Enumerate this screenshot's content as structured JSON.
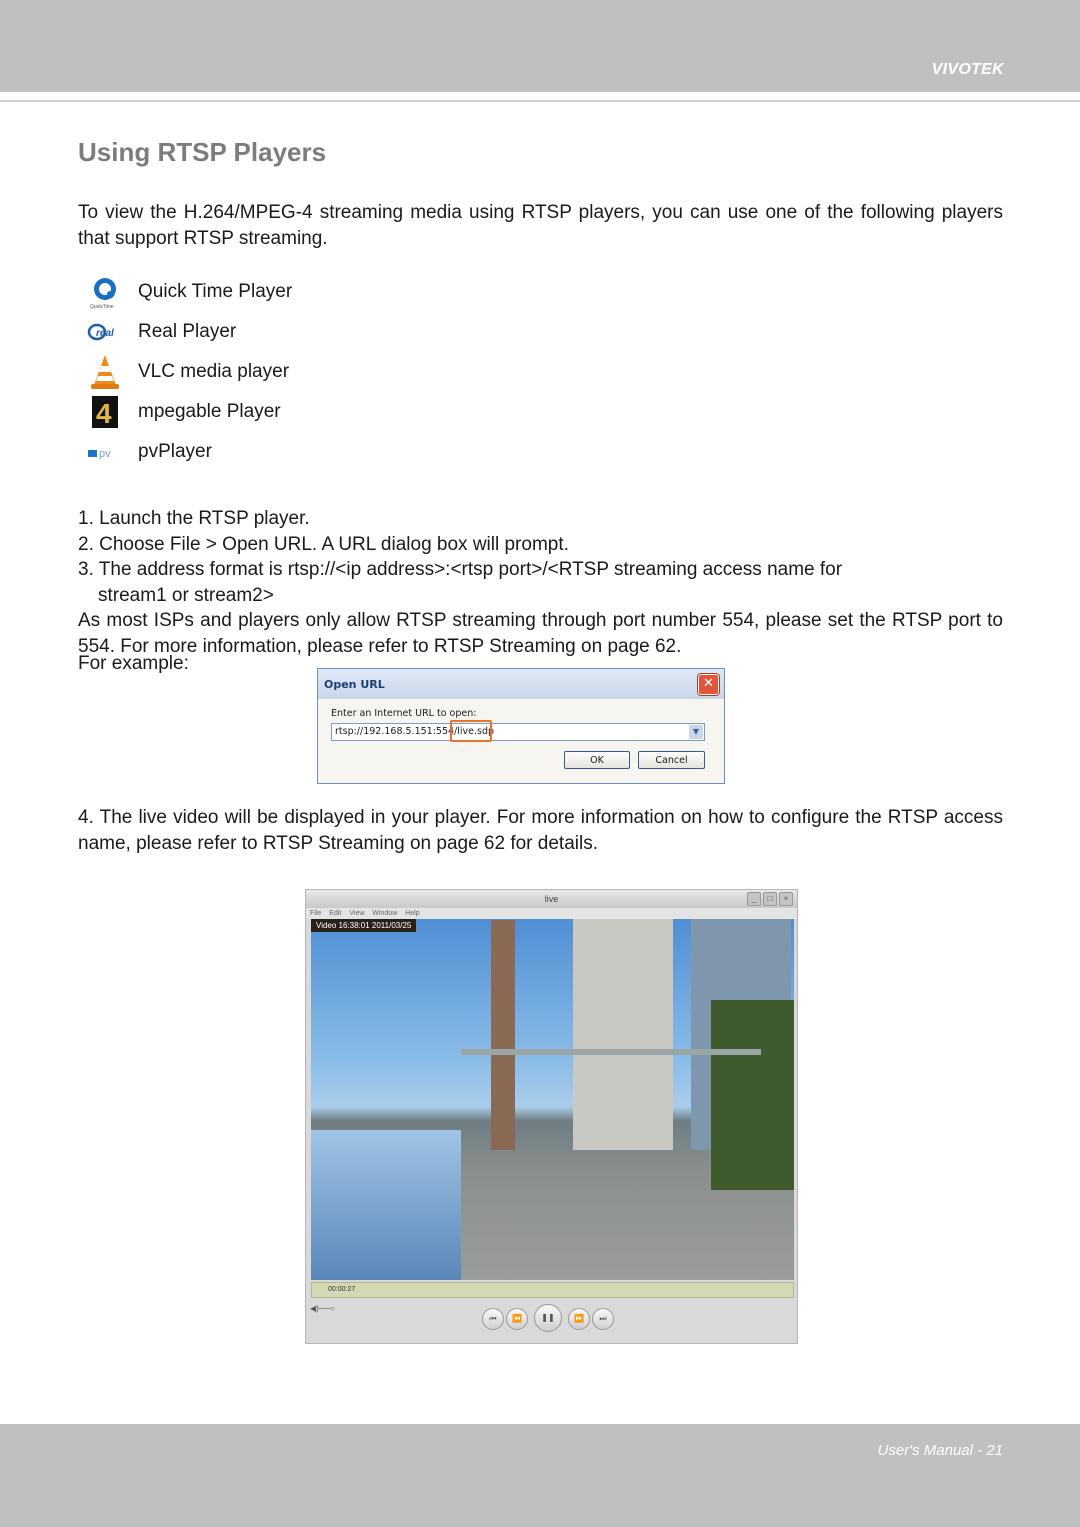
{
  "header": {
    "brand": "VIVOTEK"
  },
  "page_title": "Using RTSP Players",
  "intro": "To view the H.264/MPEG-4 streaming media using RTSP players, you can use one of the following players that support RTSP streaming.",
  "players": [
    {
      "label": "Quick Time Player",
      "icon": "quicktime-icon"
    },
    {
      "label": "Real Player",
      "icon": "realplayer-icon"
    },
    {
      "label": "VLC media player",
      "icon": "vlc-cone-icon"
    },
    {
      "label": "mpegable Player",
      "icon": "mpegable-icon"
    },
    {
      "label": "pvPlayer",
      "icon": "pvplayer-icon"
    }
  ],
  "steps": {
    "s1": "1. Launch the RTSP player.",
    "s2": "2. Choose File > Open URL. A URL dialog box will prompt.",
    "s3a": "3. The address format is rtsp://<ip address>:<rtsp port>/<RTSP streaming access name for",
    "s3b": "stream1 or stream2>",
    "note": "As most ISPs and players only allow RTSP streaming through port number 554, please set the RTSP port to 554. For more information, please refer to RTSP Streaming on page 62.",
    "example": "For example:",
    "s4": "4. The live video will be displayed in your player. For more information on how to configure the RTSP access name, please refer to RTSP Streaming on page 62 for details."
  },
  "dialog": {
    "title": "Open URL",
    "close": "✕",
    "label": "Enter an Internet URL to open:",
    "url_value": "rtsp://192.168.5.151:554/live.sdp",
    "ok": "OK",
    "cancel": "Cancel",
    "highlight_color": "#e8742c"
  },
  "player_window": {
    "title": "live",
    "menu": [
      "File",
      "Edit",
      "View",
      "Window",
      "Help"
    ],
    "osd": "Video 16:38:01 2011/03/25",
    "elapsed": "00:00:27",
    "buttons": {
      "prev": "⏮",
      "rew": "⏪",
      "pause": "❚❚",
      "ffwd": "⏩",
      "next": "⏭"
    }
  },
  "footer": {
    "text": "User's Manual - 21"
  }
}
